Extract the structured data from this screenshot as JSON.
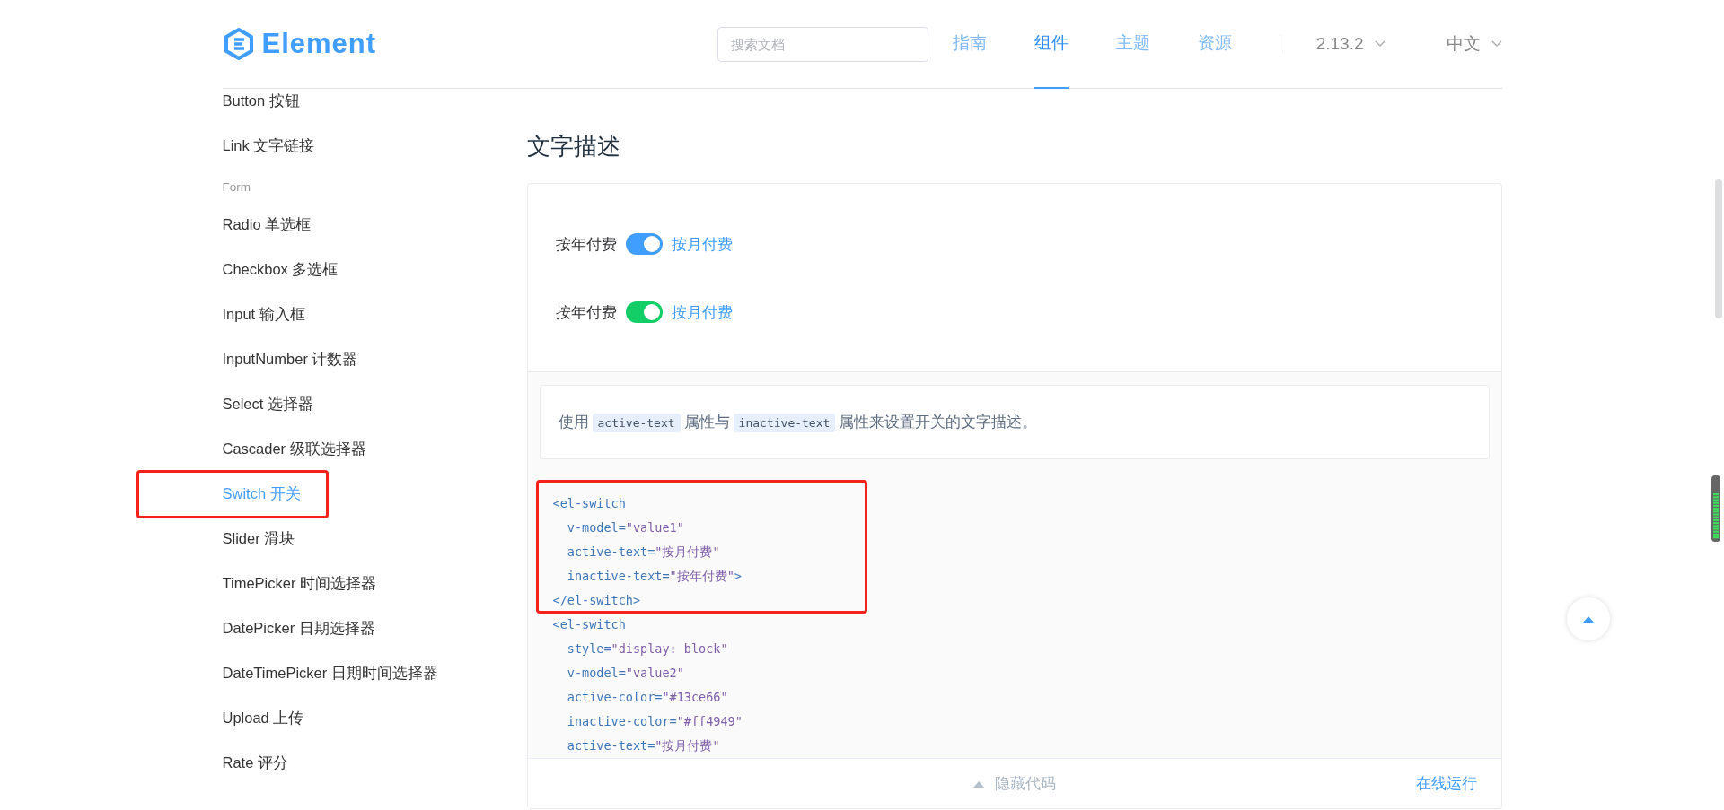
{
  "header": {
    "logo_text": "Element",
    "search": {
      "placeholder": "搜索文档"
    },
    "nav": [
      {
        "label": "指南",
        "selected": false
      },
      {
        "label": "组件",
        "selected": true
      },
      {
        "label": "主题",
        "selected": false
      },
      {
        "label": "资源",
        "selected": false
      }
    ],
    "version": "2.13.2",
    "language": "中文"
  },
  "sidebar": {
    "items": [
      {
        "kind": "link",
        "label": "Button 按钮",
        "selected": false,
        "highlighted": false
      },
      {
        "kind": "link",
        "label": "Link 文字链接",
        "selected": false,
        "highlighted": false
      },
      {
        "kind": "group",
        "label": "Form"
      },
      {
        "kind": "link",
        "label": "Radio 单选框",
        "selected": false,
        "highlighted": false
      },
      {
        "kind": "link",
        "label": "Checkbox 多选框",
        "selected": false,
        "highlighted": false
      },
      {
        "kind": "link",
        "label": "Input 输入框",
        "selected": false,
        "highlighted": false
      },
      {
        "kind": "link",
        "label": "InputNumber 计数器",
        "selected": false,
        "highlighted": false
      },
      {
        "kind": "link",
        "label": "Select 选择器",
        "selected": false,
        "highlighted": false
      },
      {
        "kind": "link",
        "label": "Cascader 级联选择器",
        "selected": false,
        "highlighted": false
      },
      {
        "kind": "link",
        "label": "Switch 开关",
        "selected": true,
        "highlighted": true
      },
      {
        "kind": "link",
        "label": "Slider 滑块",
        "selected": false,
        "highlighted": false
      },
      {
        "kind": "link",
        "label": "TimePicker 时间选择器",
        "selected": false,
        "highlighted": false
      },
      {
        "kind": "link",
        "label": "DatePicker 日期选择器",
        "selected": false,
        "highlighted": false
      },
      {
        "kind": "link",
        "label": "DateTimePicker 日期时间选择器",
        "selected": false,
        "highlighted": false
      },
      {
        "kind": "link",
        "label": "Upload 上传",
        "selected": false,
        "highlighted": false
      },
      {
        "kind": "link",
        "label": "Rate 评分",
        "selected": false,
        "highlighted": false
      }
    ]
  },
  "content": {
    "title": "文字描述",
    "switches": [
      {
        "inactive_text": "按年付费",
        "active_text": "按月付费",
        "on": true,
        "color": "#409eff"
      },
      {
        "inactive_text": "按年付费",
        "active_text": "按月付费",
        "on": true,
        "color": "#13ce66"
      }
    ],
    "description": [
      {
        "kind": "text",
        "text": "使用"
      },
      {
        "kind": "code",
        "text": "active-text"
      },
      {
        "kind": "text",
        "text": "属性与"
      },
      {
        "kind": "code",
        "text": "inactive-text"
      },
      {
        "kind": "text",
        "text": "属性来设置开关的文字描述。"
      }
    ],
    "code": {
      "snippets": [
        {
          "highlighted": true,
          "lines": [
            "<el-switch",
            "  v-model=\"value1\"",
            "  active-text=\"按月付费\"",
            "  inactive-text=\"按年付费\">",
            "</el-switch>"
          ]
        },
        {
          "highlighted": false,
          "lines": [
            "<el-switch",
            "  style=\"display: block\"",
            "  v-model=\"value2\"",
            "  active-color=\"#13ce66\"",
            "  inactive-color=\"#ff4949\"",
            "  active-text=\"按月付费\""
          ]
        }
      ]
    },
    "hide_code_label": "隐藏代码",
    "run_online_label": "在线运行"
  }
}
